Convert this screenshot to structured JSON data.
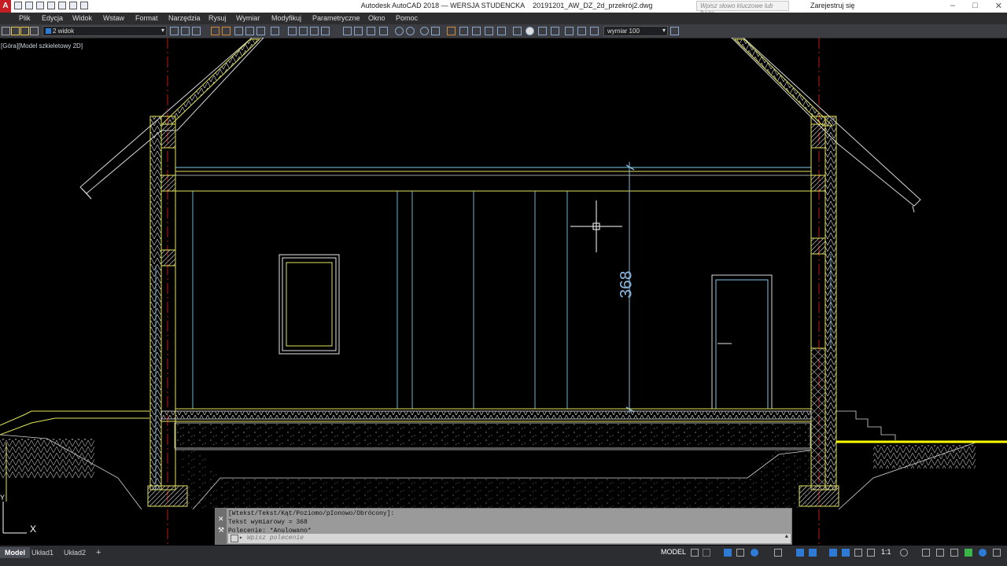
{
  "title_bar": {
    "app_title": "Autodesk AutoCAD 2018 — WERSJA STUDENCKA",
    "file_name": "20191201_AW_DZ_2d_przekrój2.dwg",
    "search_placeholder": "Wpisz słowo kluczowe lub frazę",
    "sign_in": "Zarejestruj się",
    "logo_letter": "A",
    "minimize": "–",
    "maximize": "□",
    "close": "✕"
  },
  "menu": {
    "items": [
      "Plik",
      "Edycja",
      "Widok",
      "Wstaw",
      "Format",
      "Narzędzia",
      "Rysuj",
      "Wymiar",
      "Modyfikuj",
      "Parametryczne",
      "Okno",
      "Pomoc"
    ]
  },
  "toolbar": {
    "layer_value": "2 widok",
    "dimstyle_value": "wymiar 100",
    "dropdown_glyph": "▾"
  },
  "viewport": {
    "label": "[Góra][Model szkieletowy 2D]",
    "dimension_text": "368",
    "ucs_x": "X",
    "ucs_y": "Y"
  },
  "command": {
    "history": [
      "[Wtekst/Tekst/Kąt/Poziomo/pIonowo/Obrócony]:",
      "Tekst wymiarowy = 368",
      "Polecenie: *Anulowano*"
    ],
    "input_placeholder": "Wpisz polecenie",
    "close_glyph": "✕",
    "tool_glyph": "⚒",
    "arrow_glyph": "▸",
    "scroll_glyph": "▲"
  },
  "status": {
    "layout_tabs": [
      "Model",
      "Układ1",
      "Układ2"
    ],
    "add_tab": "+",
    "model_label": "MODEL",
    "scale": "1:1"
  },
  "colors": {
    "background": "#000000",
    "wall_yellow": "#e5e55a",
    "line_cyan": "#7ec8e3",
    "line_white": "#d8d8d8",
    "axis_red": "#c01818",
    "dimension_color": "#8ab8e0",
    "bright_yellow": "#ffff00"
  }
}
